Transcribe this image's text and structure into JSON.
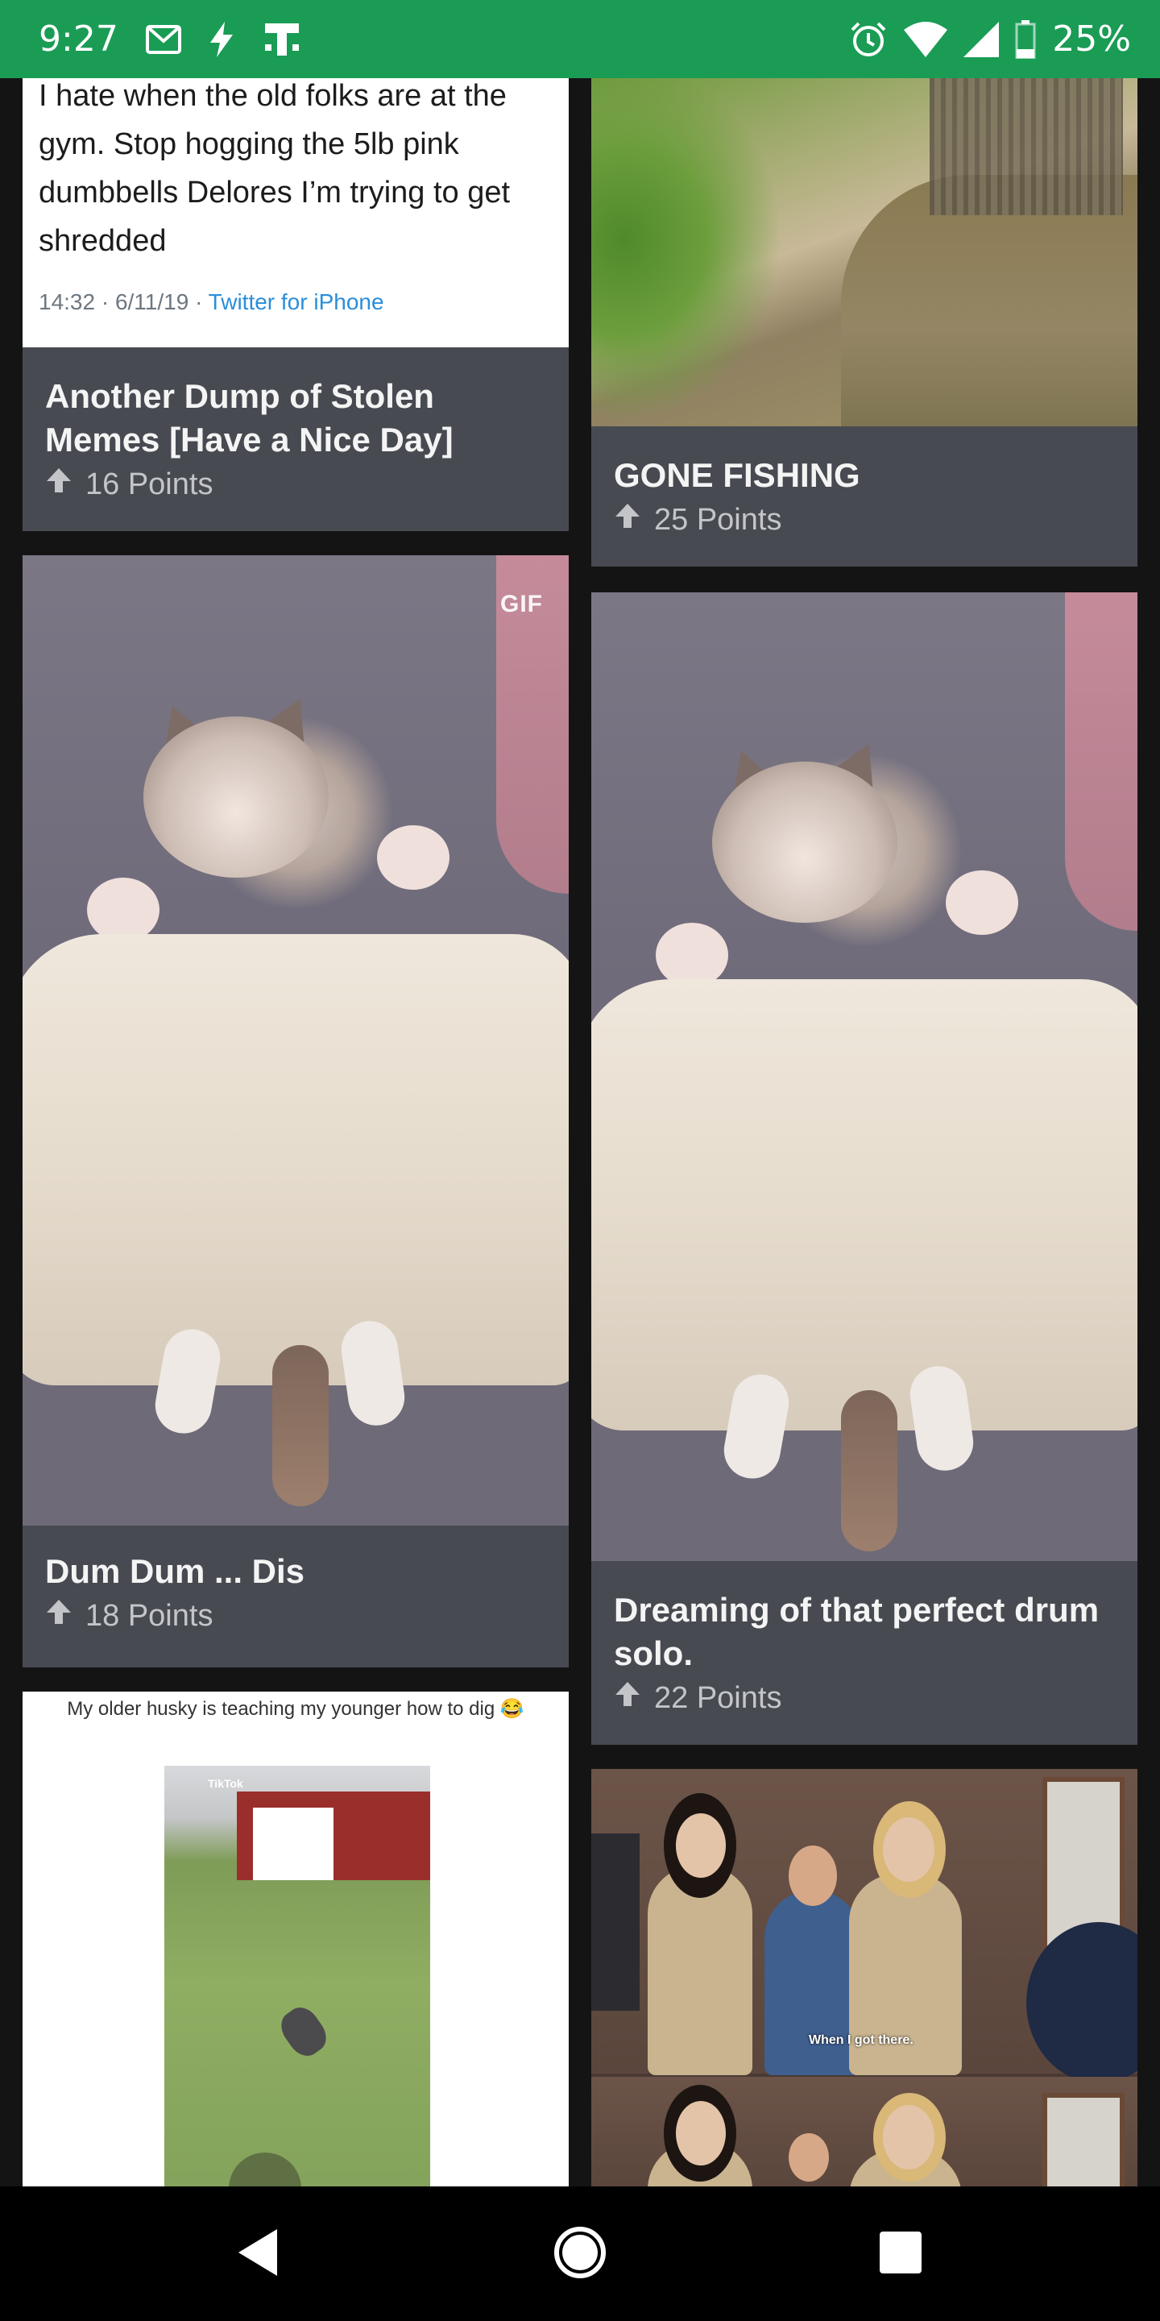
{
  "status_bar": {
    "time": "9:27",
    "battery": "25%",
    "icons": [
      "gmail-icon",
      "bolt-icon",
      "tmobile-icon",
      "alarm-icon",
      "wifi-icon",
      "signal-icon",
      "battery-icon"
    ]
  },
  "feed": {
    "left": [
      {
        "type": "tweet",
        "tweet_text": "I hate when the old folks are at the gym. Stop hogging the 5lb pink dumbbells Delores I’m trying to get shredded",
        "tweet_time": "14:32 · 6/11/19 · ",
        "tweet_source": "Twitter for iPhone",
        "title": "Another Dump of Stolen Memes [Have a Nice Day]",
        "points": "16 Points"
      },
      {
        "type": "gif",
        "badge": "GIF",
        "title": "Dum Dum ... Dis",
        "points": "18 Points"
      },
      {
        "type": "image",
        "caption": "My older husky is teaching my younger how to dig 😂",
        "watermark": "TikTok"
      }
    ],
    "right": [
      {
        "type": "image",
        "title": "GONE FISHING",
        "points": "25 Points"
      },
      {
        "type": "image",
        "title": "Dreaming of that perfect drum solo.",
        "points": "22 Points"
      },
      {
        "type": "image",
        "subtitle": "When I got there."
      }
    ]
  },
  "nav": {
    "back": "back-icon",
    "home": "home-icon",
    "recents": "recents-icon"
  },
  "colors": {
    "status_bar": "#1a9c55",
    "card_meta": "#474a51",
    "background": "#141414",
    "link": "#2a8ed9"
  }
}
